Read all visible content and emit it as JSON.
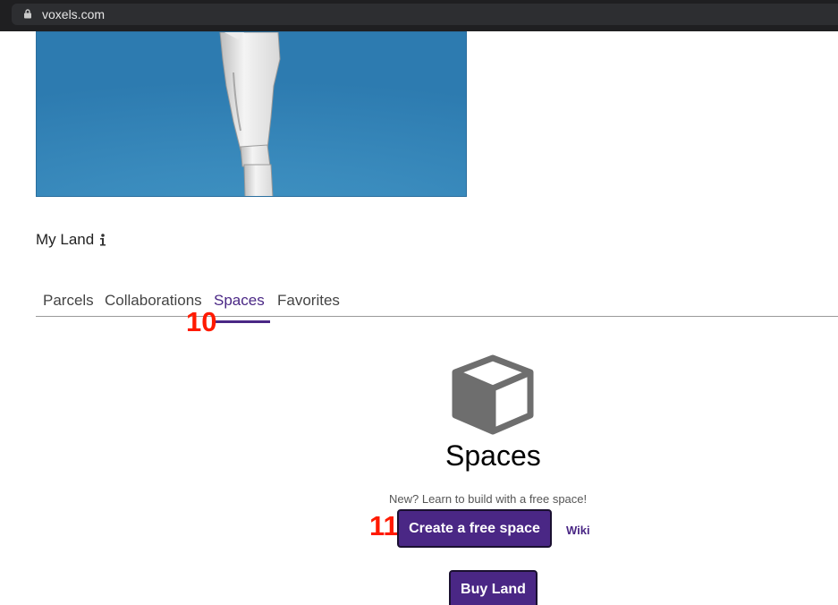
{
  "browser": {
    "url": "voxels.com"
  },
  "my_land": {
    "title": "My Land"
  },
  "tabs": [
    {
      "label": "Parcels"
    },
    {
      "label": "Collaborations"
    },
    {
      "label": "Spaces",
      "active": true
    },
    {
      "label": "Favorites"
    }
  ],
  "annotations": {
    "tab_marker": "10",
    "button_marker": "11"
  },
  "spaces": {
    "heading": "Spaces",
    "hint": "New? Learn to build with a free space!",
    "create_label": "Create a free space",
    "wiki_label": "Wiki",
    "buy_label": "Buy Land"
  },
  "colors": {
    "accent": "#4a2785",
    "annotation": "#ff1a00"
  },
  "icons": {
    "lock": "lock-icon",
    "info": "info-icon",
    "cube": "cube-icon"
  }
}
